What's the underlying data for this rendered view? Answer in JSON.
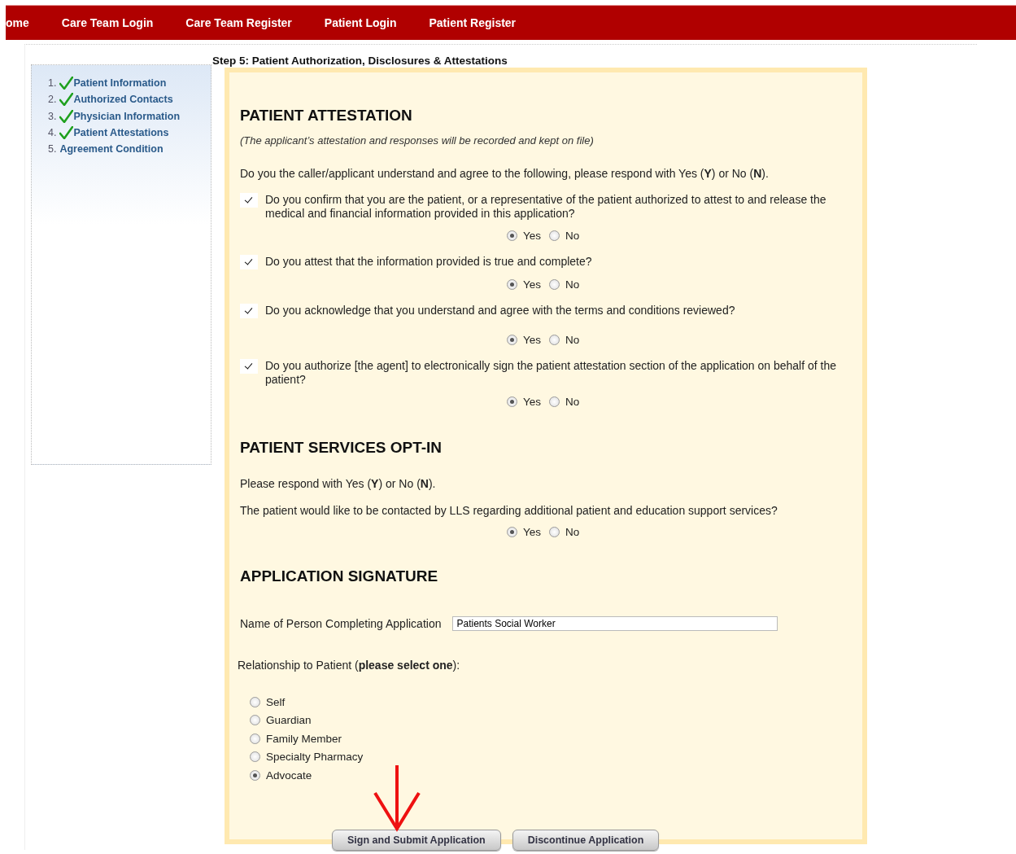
{
  "nav": [
    {
      "label": "ome"
    },
    {
      "label": "Care Team Login"
    },
    {
      "label": "Care Team Register"
    },
    {
      "label": "Patient Login"
    },
    {
      "label": "Patient Register"
    }
  ],
  "steps": [
    {
      "number": "1.",
      "label": "Patient Information",
      "completed": true
    },
    {
      "number": "2.",
      "label": "Authorized Contacts",
      "completed": true
    },
    {
      "number": "3.",
      "label": "Physician Information",
      "completed": true
    },
    {
      "number": "4.",
      "label": "Patient Attestations",
      "completed": true
    },
    {
      "number": "5.",
      "label": "Agreement Condition",
      "completed": false
    }
  ],
  "step_title": "Step 5: Patient Authorization, Disclosures & Attestations",
  "attestation": {
    "heading": "PATIENT ATTESTATION",
    "note": "(The applicant’s attestation and responses will be recorded and kept on file)",
    "intro": "Do you the caller/applicant understand and agree to the following, please respond with Yes (**Y**) or No (**N**).",
    "questions": [
      {
        "text": "Do you confirm that you are the patient, or a representative of the patient authorized to attest to and release the medical and financial information provided in this application?",
        "checked": true,
        "options": [
          {
            "label": "Yes",
            "selected": true
          },
          {
            "label": "No",
            "selected": false
          }
        ]
      },
      {
        "text": "Do you attest that the information provided is true and complete?",
        "checked": true,
        "options": [
          {
            "label": "Yes",
            "selected": true
          },
          {
            "label": "No",
            "selected": false
          }
        ]
      },
      {
        "text": "Do you acknowledge that you understand and agree with the terms and conditions reviewed?",
        "checked": true,
        "options": [
          {
            "label": "Yes",
            "selected": true
          },
          {
            "label": "No",
            "selected": false
          }
        ]
      },
      {
        "text": "Do you authorize [the agent] to electronically sign the patient attestation section of the application on behalf of the patient?",
        "checked": true,
        "options": [
          {
            "label": "Yes",
            "selected": true
          },
          {
            "label": "No",
            "selected": false
          }
        ]
      }
    ]
  },
  "opt_in": {
    "heading": "PATIENT SERVICES OPT-IN",
    "intro": "Please respond with Yes (**Y**) or No (**N**).",
    "question": "The patient would like to be contacted by LLS regarding additional patient and education support services?",
    "options": [
      {
        "label": "Yes",
        "selected": true
      },
      {
        "label": "No",
        "selected": false
      }
    ]
  },
  "signature": {
    "heading": "APPLICATION SIGNATURE",
    "name_label": "Name of Person Completing Application",
    "name_value": "Patients Social Worker",
    "relationship_label": "Relationship to Patient (**please select one**):",
    "relationships": [
      {
        "label": "Self",
        "selected": false
      },
      {
        "label": "Guardian",
        "selected": false
      },
      {
        "label": "Family Member",
        "selected": false
      },
      {
        "label": "Specialty Pharmacy",
        "selected": false
      },
      {
        "label": "Advocate",
        "selected": true
      }
    ]
  },
  "buttons": [
    {
      "label": "Sign and Submit Application"
    },
    {
      "label": "Discontinue Application"
    }
  ]
}
